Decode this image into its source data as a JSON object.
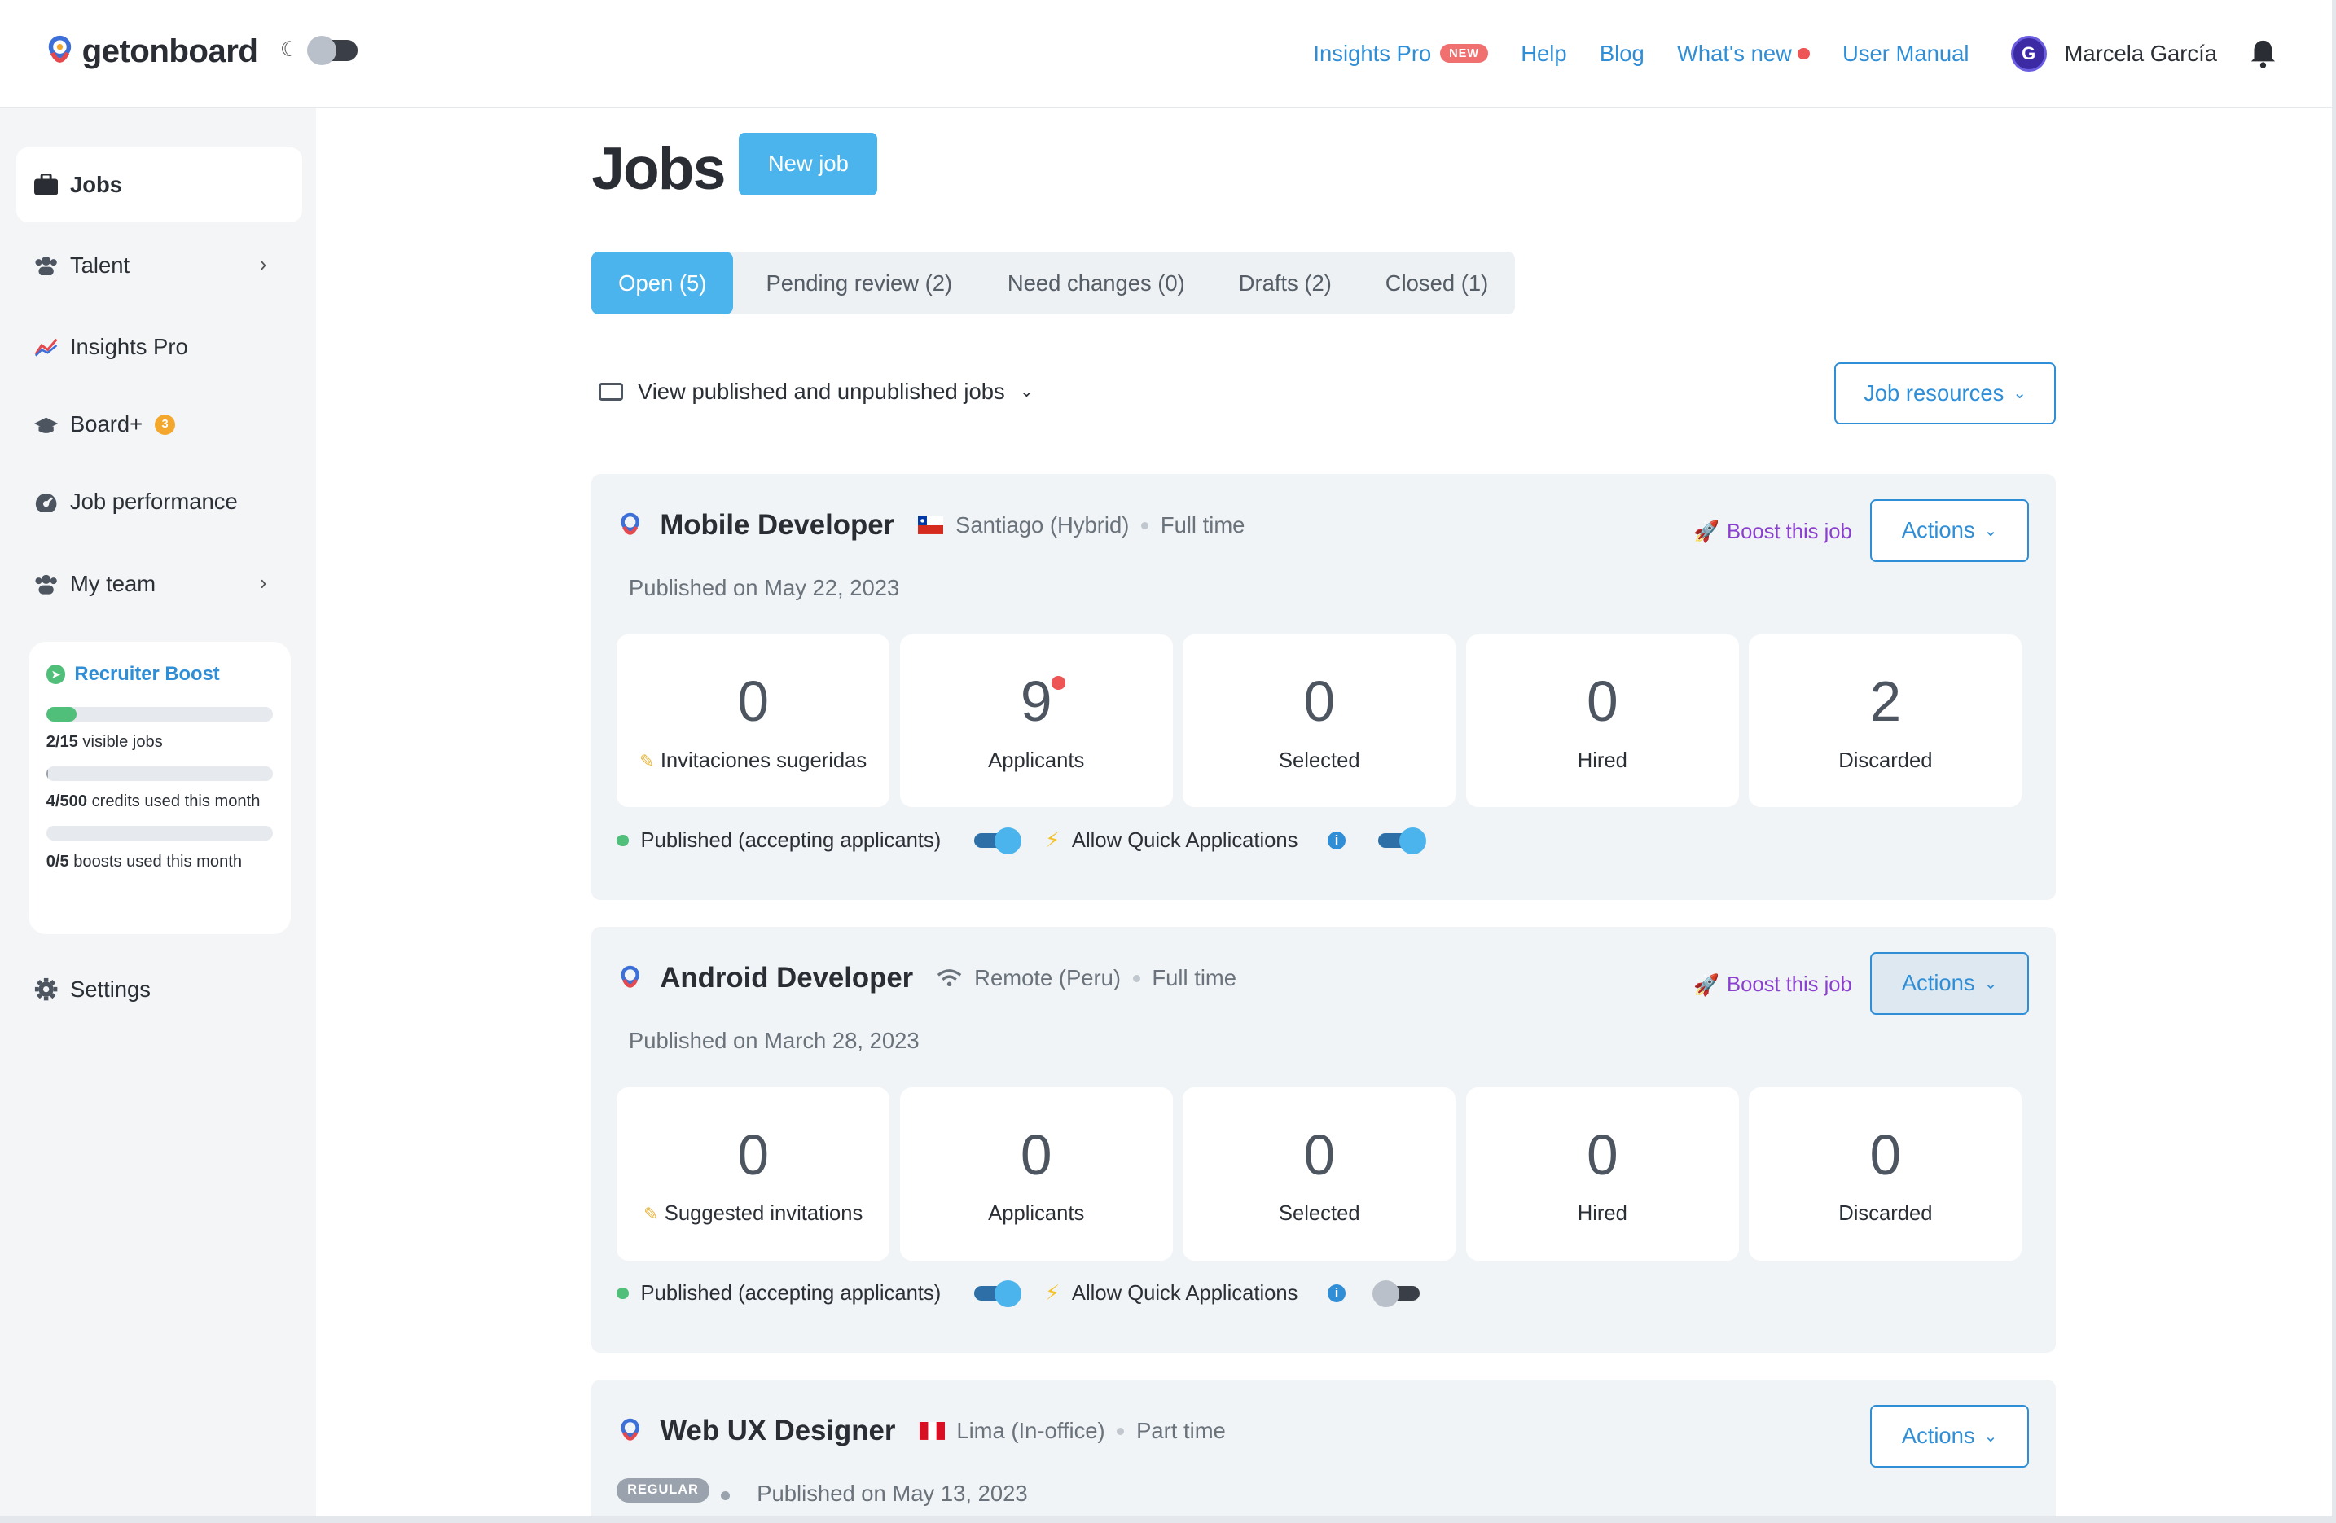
{
  "header": {
    "logo_text": "getonboard",
    "nav": [
      {
        "label": "Insights Pro",
        "badge": "NEW"
      },
      {
        "label": "Help"
      },
      {
        "label": "Blog"
      },
      {
        "label": "What's new"
      },
      {
        "label": "User Manual"
      }
    ],
    "user_name": "Marcela García",
    "avatar_initial": "G"
  },
  "sidebar": {
    "items": [
      {
        "label": "Jobs",
        "icon": "briefcase-icon"
      },
      {
        "label": "Talent",
        "icon": "users-icon"
      },
      {
        "label": "Insights Pro",
        "icon": "chart-icon"
      },
      {
        "label": "Board+",
        "icon": "graduation-cap-icon",
        "badge": "3"
      },
      {
        "label": "Job performance",
        "icon": "gauge-icon"
      },
      {
        "label": "My team",
        "icon": "team-icon"
      },
      {
        "label": "Settings",
        "icon": "gear-icon"
      }
    ],
    "recruiter_boost": {
      "title": "Recruiter Boost",
      "visible_jobs": {
        "used": "2/15",
        "label": "visible jobs",
        "fraction": 0.133
      },
      "credits": {
        "used": "4/500",
        "label": "credits used this month",
        "fraction": 0.008
      },
      "boosts": {
        "used": "0/5",
        "label": "boosts used this month",
        "fraction": 0.0
      }
    }
  },
  "main": {
    "title": "Jobs",
    "new_job_label": "New job",
    "tabs": [
      "Open (5)",
      "Pending review (2)",
      "Need changes (0)",
      "Drafts (2)",
      "Closed (1)"
    ],
    "view_filter": "View published and unpublished jobs",
    "job_resources_label": "Job resources",
    "boost_label": "Boost this job",
    "actions_label": "Actions",
    "jobs": [
      {
        "title": "Mobile Developer",
        "location": "Santiago (Hybrid)",
        "type": "Full time",
        "published": "Published on May 22, 2023",
        "stats": [
          {
            "value": "0",
            "label": "Invitaciones sugeridas"
          },
          {
            "value": "9",
            "label": "Applicants"
          },
          {
            "value": "0",
            "label": "Selected"
          },
          {
            "value": "0",
            "label": "Hired"
          },
          {
            "value": "2",
            "label": "Discarded"
          }
        ],
        "published_toggle": "Published (accepting applicants)",
        "quick_apply": "Allow Quick Applications"
      },
      {
        "title": "Android Developer",
        "location": "Remote (Peru)",
        "type": "Full time",
        "published": "Published on March 28, 2023",
        "stats": [
          {
            "value": "0",
            "label": "Suggested invitations"
          },
          {
            "value": "0",
            "label": "Applicants"
          },
          {
            "value": "0",
            "label": "Selected"
          },
          {
            "value": "0",
            "label": "Hired"
          },
          {
            "value": "0",
            "label": "Discarded"
          }
        ],
        "published_toggle": "Published (accepting applicants)",
        "quick_apply": "Allow Quick Applications"
      },
      {
        "title": "Web UX Designer",
        "location": "Lima (In-office)",
        "type": "Part time",
        "badge": "REGULAR",
        "published": "Published on May 13, 2023"
      }
    ]
  },
  "colors": {
    "accent": "#4cb4ec",
    "link": "#2f8ed6",
    "boost": "#8a3fcf",
    "success": "#4fbf7a"
  }
}
